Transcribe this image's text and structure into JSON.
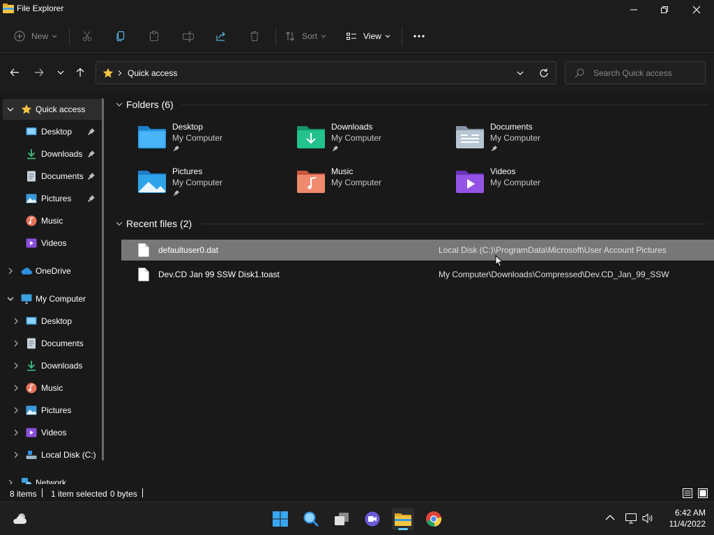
{
  "window": {
    "title": "File Explorer"
  },
  "toolbar": {
    "new_label": "New",
    "sort_label": "Sort",
    "view_label": "View"
  },
  "address": {
    "current": "Quick access"
  },
  "search": {
    "placeholder": "Search Quick access"
  },
  "nav": {
    "quick_access": "Quick access",
    "quick_items": [
      {
        "label": "Desktop",
        "icon": "desktop-icon",
        "pinned": true
      },
      {
        "label": "Downloads",
        "icon": "downloads-icon",
        "pinned": true
      },
      {
        "label": "Documents",
        "icon": "documents-icon",
        "pinned": true
      },
      {
        "label": "Pictures",
        "icon": "pictures-icon",
        "pinned": true
      },
      {
        "label": "Music",
        "icon": "music-icon",
        "pinned": false
      },
      {
        "label": "Videos",
        "icon": "videos-icon",
        "pinned": false
      }
    ],
    "onedrive": "OneDrive",
    "my_computer": "My Computer",
    "computer_items": [
      {
        "label": "Desktop",
        "icon": "desktop-icon"
      },
      {
        "label": "Documents",
        "icon": "documents-icon"
      },
      {
        "label": "Downloads",
        "icon": "downloads-icon"
      },
      {
        "label": "Music",
        "icon": "music-icon"
      },
      {
        "label": "Pictures",
        "icon": "pictures-icon"
      },
      {
        "label": "Videos",
        "icon": "videos-icon"
      },
      {
        "label": "Local Disk (C:)",
        "icon": "drive-icon"
      }
    ],
    "network": "Network"
  },
  "content": {
    "folders_header": "Folders (6)",
    "folders": [
      {
        "name": "Desktop",
        "location": "My Computer",
        "pinned": true,
        "icon": "desktop-folder-icon"
      },
      {
        "name": "Downloads",
        "location": "My Computer",
        "pinned": true,
        "icon": "downloads-folder-icon"
      },
      {
        "name": "Documents",
        "location": "My Computer",
        "pinned": true,
        "icon": "documents-folder-icon"
      },
      {
        "name": "Pictures",
        "location": "My Computer",
        "pinned": true,
        "icon": "pictures-folder-icon"
      },
      {
        "name": "Music",
        "location": "My Computer",
        "pinned": false,
        "icon": "music-folder-icon"
      },
      {
        "name": "Videos",
        "location": "My Computer",
        "pinned": false,
        "icon": "videos-folder-icon"
      }
    ],
    "recent_header": "Recent files (2)",
    "recent": [
      {
        "name": "defaultuser0.dat",
        "path": "Local Disk (C:)\\ProgramData\\Microsoft\\User Account Pictures",
        "selected": true
      },
      {
        "name": "Dev.CD Jan 99 SSW Disk1.toast",
        "path": "My Computer\\Downloads\\Compressed\\Dev.CD_Jan_99_SSW",
        "selected": false
      }
    ]
  },
  "status": {
    "items": "8 items",
    "selected": "1 item selected",
    "size": "0 bytes"
  },
  "clock": {
    "time": "6:42 AM",
    "date": "11/4/2022"
  },
  "colors": {
    "selected_row": "#777777",
    "accent": "#60cdff",
    "folder_yellow": "#f4c542"
  }
}
